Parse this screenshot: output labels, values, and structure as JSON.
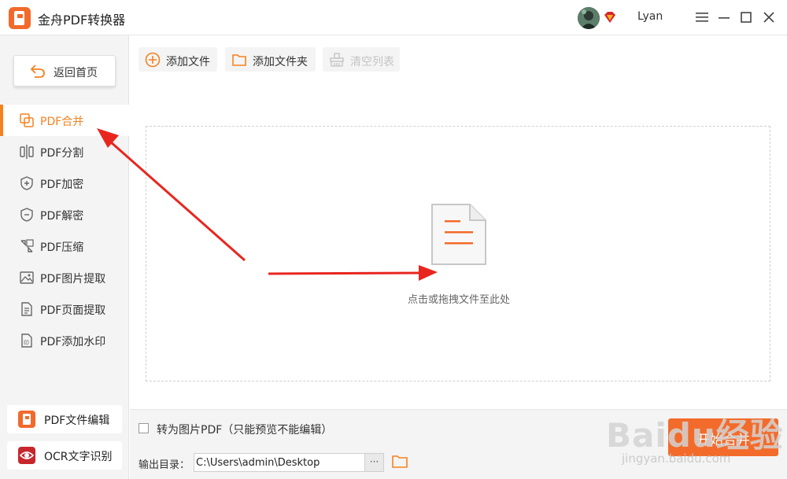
{
  "window": {
    "app_title": "金舟PDF转换器",
    "username": "Lyan"
  },
  "sidebar": {
    "back_label": "返回首页",
    "items": [
      {
        "label": "PDF合并",
        "icon": "merge-icon",
        "active": true
      },
      {
        "label": "PDF分割",
        "icon": "split-icon",
        "active": false
      },
      {
        "label": "PDF加密",
        "icon": "shield-plus-icon",
        "active": false
      },
      {
        "label": "PDF解密",
        "icon": "shield-minus-icon",
        "active": false
      },
      {
        "label": "PDF压缩",
        "icon": "compress-icon",
        "active": false
      },
      {
        "label": "PDF图片提取",
        "icon": "image-icon",
        "active": false
      },
      {
        "label": "PDF页面提取",
        "icon": "page-icon",
        "active": false
      },
      {
        "label": "PDF添加水印",
        "icon": "watermark-icon",
        "active": false
      }
    ],
    "tools": [
      {
        "label": "PDF文件编辑",
        "icon": "pdf-edit-icon",
        "color": "#f26a2b"
      },
      {
        "label": "OCR文字识别",
        "icon": "ocr-eye-icon",
        "color": "#c8262d"
      }
    ]
  },
  "toolbar": {
    "add_file": "添加文件",
    "add_folder": "添加文件夹",
    "clear_list": "清空列表"
  },
  "dropzone": {
    "hint": "点击或拖拽文件至此处"
  },
  "bottom": {
    "convert_to_image_pdf": "转为图片PDF（只能预览不能编辑）",
    "output_label": "输出目录：",
    "output_path": "C:\\Users\\admin\\Desktop",
    "browse": "···",
    "start_label": "开始合并"
  },
  "watermark": {
    "brand": "Baidu经验",
    "url": "jingyan.baidu.com"
  },
  "colors": {
    "accent": "#f5811f",
    "start_button": "#f36b2b",
    "annotation_arrow": "#e8261f"
  }
}
